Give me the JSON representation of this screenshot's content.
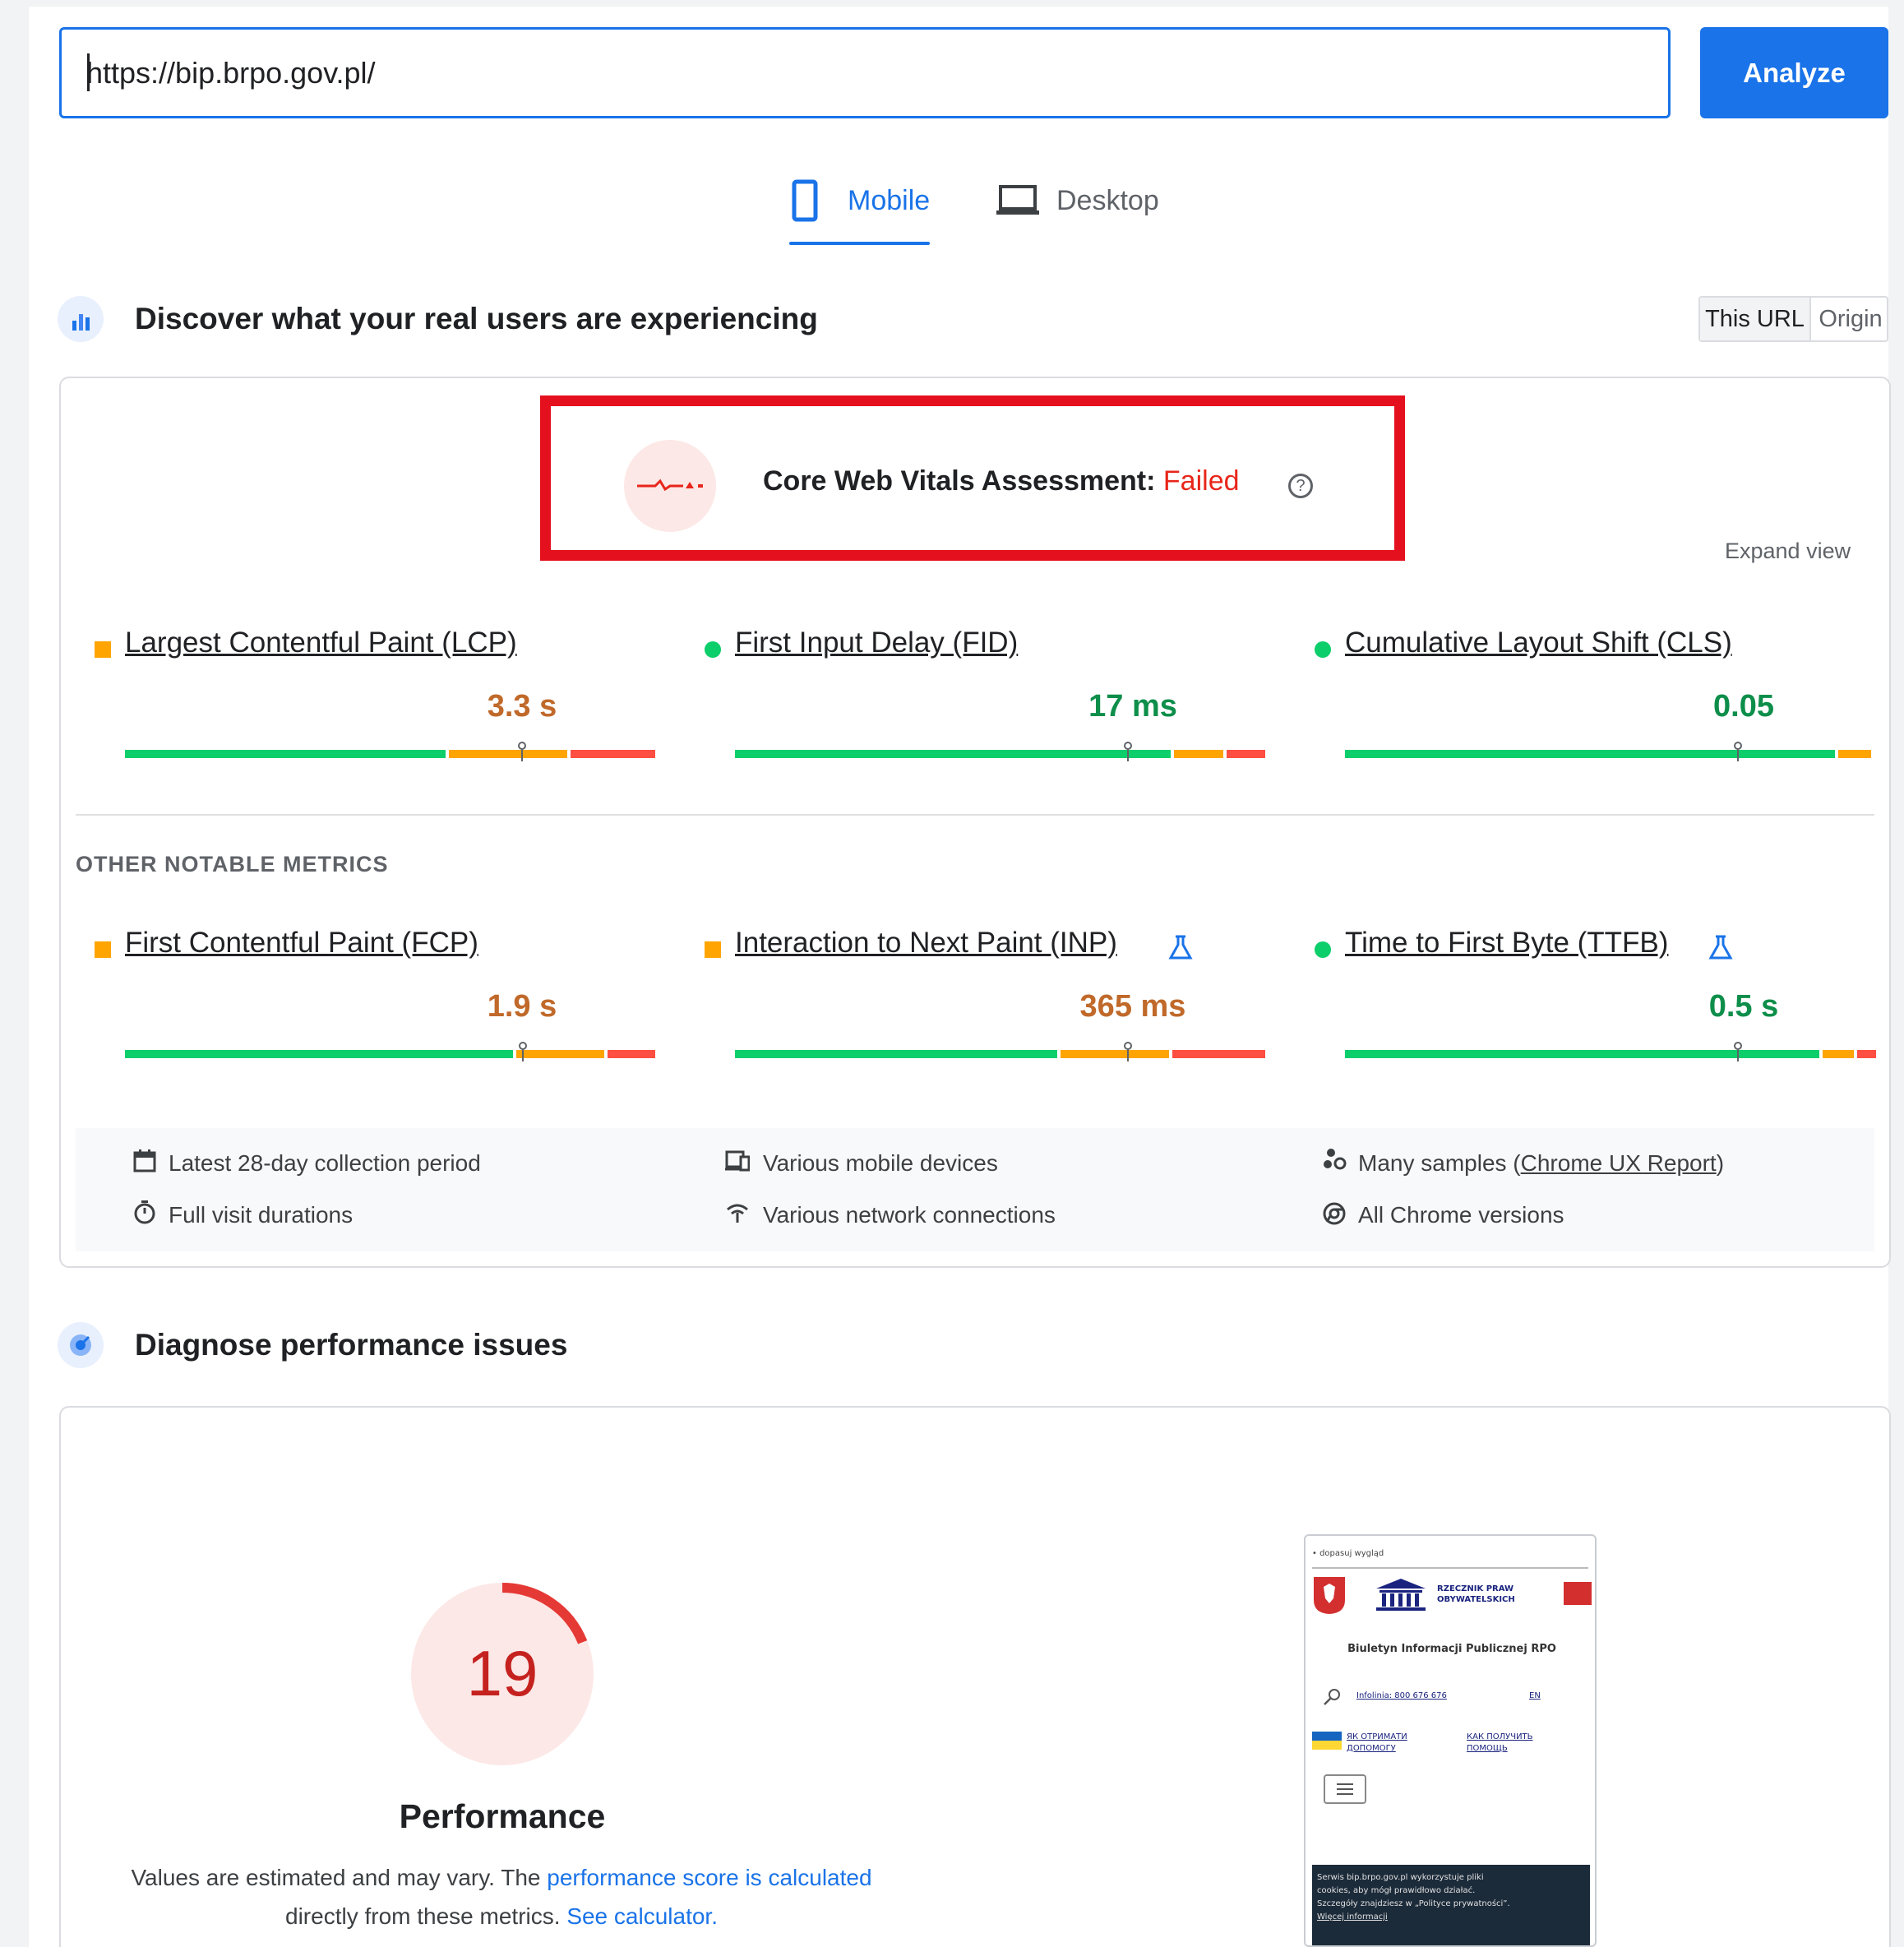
{
  "url_bar": {
    "value": "https://bip.brpo.gov.pl/",
    "analyze_label": "Analyze"
  },
  "tabs": [
    {
      "label": "Mobile",
      "active": true
    },
    {
      "label": "Desktop",
      "active": false
    }
  ],
  "field_section": {
    "title": "Discover what your real users are experiencing",
    "toggle": {
      "this_url": "This URL",
      "origin": "Origin",
      "selected": "This URL"
    },
    "assessment": {
      "label": "Core Web Vitals Assessment:",
      "status": "Failed"
    },
    "expand_label": "Expand view",
    "core_metrics": [
      {
        "name": "Largest Contentful Paint (LCP)",
        "value": "3.3 s",
        "rating": "needs-improvement",
        "experimental": false
      },
      {
        "name": "First Input Delay (FID)",
        "value": "17 ms",
        "rating": "good",
        "experimental": false
      },
      {
        "name": "Cumulative Layout Shift (CLS)",
        "value": "0.05",
        "rating": "good",
        "experimental": false
      }
    ],
    "other_title": "OTHER NOTABLE METRICS",
    "other_metrics": [
      {
        "name": "First Contentful Paint (FCP)",
        "value": "1.9 s",
        "rating": "needs-improvement",
        "experimental": false
      },
      {
        "name": "Interaction to Next Paint (INP)",
        "value": "365 ms",
        "rating": "needs-improvement",
        "experimental": true
      },
      {
        "name": "Time to First Byte (TTFB)",
        "value": "0.5 s",
        "rating": "good",
        "experimental": true
      }
    ],
    "info": {
      "period": "Latest 28-day collection period",
      "durations": "Full visit durations",
      "devices": "Various mobile devices",
      "network": "Various network connections",
      "samples_prefix": "Many samples (",
      "samples_link": "Chrome UX Report",
      "samples_suffix": ")",
      "chrome": "All Chrome versions"
    }
  },
  "diagnose_section": {
    "title": "Diagnose performance issues",
    "score": {
      "value": "19",
      "fraction": 0.19
    },
    "score_label": "Performance",
    "desc_1": "Values are estimated and may vary. The ",
    "desc_link_1": "performance score is calculated",
    "desc_2": "directly from these metrics. ",
    "desc_link_2": "See calculator."
  },
  "preview": {
    "top_link": "• dopasuj wygląd",
    "org_name_1": "RZECZNIK PRAW",
    "org_name_2": "OBYWATELSKICH",
    "heading": "Biuletyn Informacji Publicznej RPO",
    "infolinia": "Infolinia: 800 676 676",
    "lang": "EN",
    "ua_link_1": "ЯК ОТРИМАТИ",
    "ua_link_2": "ДОПОМОГУ",
    "ru_link_1": "КАК ПОЛУЧИТЬ",
    "ru_link_2": "ПОМОЩЬ",
    "cookie_1": "Serwis bip.brpo.gov.pl wykorzystuje pliki",
    "cookie_2": "cookies, aby mógł prawidłowo działać.",
    "cookie_3": "Szczegóły znajdziesz w „Polityce prywatności”.",
    "cookie_4": "Więcej informacji"
  },
  "colors": {
    "accent": "#1a73e8",
    "fail": "#e8261b",
    "good": "#0cce6b",
    "avg": "#ffa400",
    "poor": "#ff4e42"
  }
}
